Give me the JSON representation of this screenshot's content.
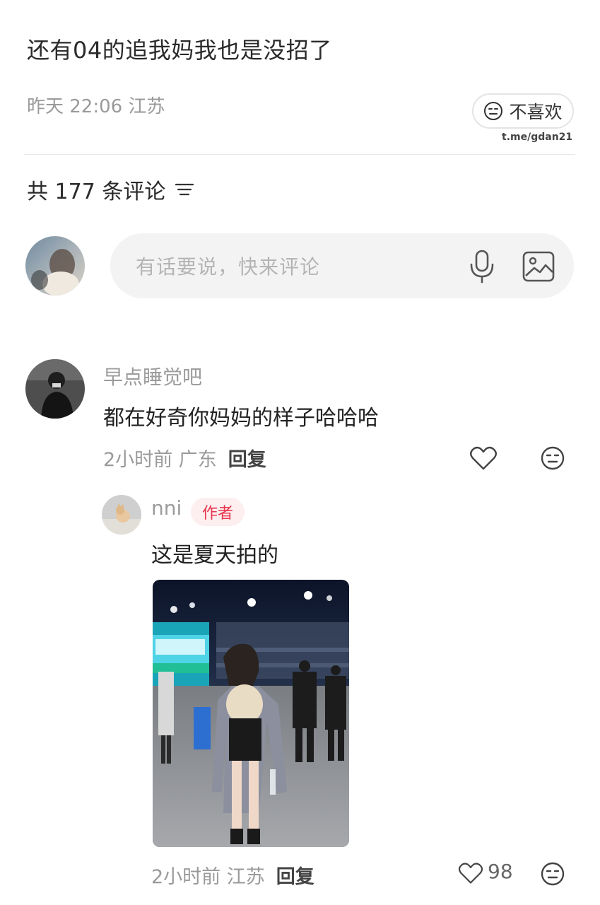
{
  "post": {
    "title": "还有04的追我妈我也是没招了",
    "meta": "昨天 22:06 江苏",
    "dislike_label": "不喜欢",
    "watermark": "t.me/gdan21"
  },
  "comments_header": {
    "count_label": "共 177 条评论",
    "sort_icon": "sort-lines-icon"
  },
  "comment_input": {
    "placeholder": "有话要说，快来评论",
    "voice_icon": "microphone-icon",
    "image_icon": "image-icon"
  },
  "comments": [
    {
      "username": "早点睡觉吧",
      "text": "都在好奇你妈妈的样子哈哈哈",
      "meta": "2小时前 广东",
      "reply_label": "回复",
      "replies": [
        {
          "username": "nni",
          "badge": "作者",
          "text": "这是夏天拍的",
          "meta": "2小时前 江苏",
          "reply_label": "回复",
          "like_count": "98"
        }
      ]
    }
  ],
  "colors": {
    "badge_text": "#e8334a",
    "badge_bg": "#fdeef0",
    "muted_text": "#9a9a9a",
    "input_bg": "#f3f3f3"
  }
}
